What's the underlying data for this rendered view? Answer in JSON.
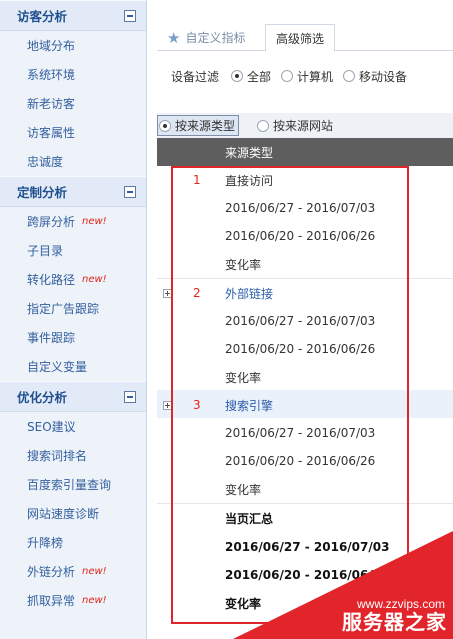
{
  "sidebar": {
    "sections": [
      {
        "title": "访客分析",
        "items": [
          {
            "label": "地域分布",
            "badge": ""
          },
          {
            "label": "系统环境",
            "badge": ""
          },
          {
            "label": "新老访客",
            "badge": ""
          },
          {
            "label": "访客属性",
            "badge": ""
          },
          {
            "label": "忠诚度",
            "badge": ""
          }
        ]
      },
      {
        "title": "定制分析",
        "items": [
          {
            "label": "跨屏分析",
            "badge": "new!"
          },
          {
            "label": "子目录",
            "badge": ""
          },
          {
            "label": "转化路径",
            "badge": "new!"
          },
          {
            "label": "指定广告跟踪",
            "badge": ""
          },
          {
            "label": "事件跟踪",
            "badge": ""
          },
          {
            "label": "自定义变量",
            "badge": ""
          }
        ]
      },
      {
        "title": "优化分析",
        "items": [
          {
            "label": "SEO建议",
            "badge": ""
          },
          {
            "label": "搜索词排名",
            "badge": ""
          },
          {
            "label": "百度索引量查询",
            "badge": ""
          },
          {
            "label": "网站速度诊断",
            "badge": ""
          },
          {
            "label": "升降榜",
            "badge": ""
          },
          {
            "label": "外链分析",
            "badge": "new!"
          },
          {
            "label": "抓取异常",
            "badge": "new!"
          }
        ]
      }
    ]
  },
  "tabs": {
    "custom_metrics": "自定义指标",
    "advanced_filter": "高级筛选"
  },
  "device_filter": {
    "label": "设备过滤",
    "options": [
      "全部",
      "计算机",
      "移动设备"
    ],
    "selected": "全部"
  },
  "source_options": {
    "by_type": "按来源类型",
    "by_site": "按来源网站",
    "selected": "按来源类型"
  },
  "table": {
    "header": "来源类型",
    "groups": [
      {
        "rank": "1",
        "name": "直接访问",
        "period1": "2016/06/27 - 2016/07/03",
        "period2": "2016/06/20 - 2016/06/26",
        "change": "变化率"
      },
      {
        "rank": "2",
        "name": "外部链接",
        "period1": "2016/06/27 - 2016/07/03",
        "period2": "2016/06/20 - 2016/06/26",
        "change": "变化率"
      },
      {
        "rank": "3",
        "name": "搜索引擎",
        "period1": "2016/06/27 - 2016/07/03",
        "period2": "2016/06/20 - 2016/06/26",
        "change": "变化率"
      }
    ],
    "summary": {
      "title": "当页汇总",
      "period1": "2016/06/27 - 2016/07/03",
      "period2": "2016/06/20 - 2016/06/26",
      "change": "变化率"
    }
  },
  "watermark": {
    "url": "www.zzvips.com",
    "name": "服务器之家"
  },
  "colors": {
    "accent": "#e2231a",
    "link": "#2a5caa",
    "header_bg": "#5e5e5e"
  }
}
